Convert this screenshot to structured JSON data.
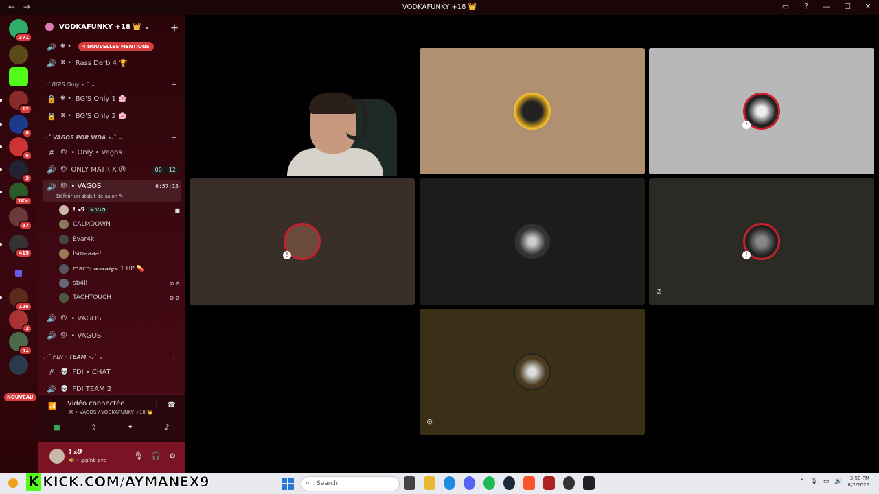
{
  "window": {
    "title": "VODKAFUNKY +18 👑",
    "nav_back": "←",
    "nav_forward": "→",
    "ctrl": [
      "▭",
      "?",
      "—",
      "☐",
      "✕"
    ]
  },
  "servers": {
    "badges": [
      "371",
      "12",
      "8",
      "6",
      "3",
      "1K+",
      "87",
      "415",
      "126",
      "2",
      "41"
    ],
    "nouveau": "NOUVEAU"
  },
  "server": {
    "name": "VODKAFUNKY +18 👑",
    "chevron": "⌄",
    "add_member": "＋"
  },
  "channels": {
    "c1_decor": "❋ •",
    "mention": "4 NOUVELLES MENTIONS",
    "c2_decor": "❋ •",
    "c2_name": "Rass Derb 4 🏆",
    "cat_bg": ".·˚ BG'S Only ⋆.˚ ⌄",
    "bg1": "BG'S Only 1 🌸",
    "bg2": "BG'S Only 2 🌸",
    "bg_decor": "❋ •",
    "cat_vagos": ".·˚ VAGOS POR VIDA ⋆.˚ ⌄",
    "only_vagos": "• Only • Vagos",
    "only_matrix": "ONLY MATRIX 😠",
    "matrix_count_a": "00",
    "matrix_count_b": "12",
    "vagos_active": "• VAGOS",
    "vagos_timer": "6:57:15",
    "status_prompt": "Définir un statut de salon ✎",
    "vagos2": "• VAGOS",
    "vagos3": "• VAGOS",
    "cat_fdi": ".·˚ FDI · TEAM ⋆.˚ ⌄",
    "fdi_chat": "FDI • CHAT",
    "fdi_team2": "FDI TEAM 2",
    "plus": "+"
  },
  "voice_users": [
    {
      "name": "! 𝓍9",
      "tag": "☠ VxG",
      "muted": ""
    },
    {
      "name": "CALMDOWN",
      "tag": "",
      "muted": ""
    },
    {
      "name": "Evar4k",
      "tag": "",
      "muted": ""
    },
    {
      "name": "Ismaaaa!",
      "tag": "",
      "muted": ""
    },
    {
      "name": "machi 𝓶𝓮𝓻𝓷𝓲𝓰𝓪 1 HP 💊",
      "tag": "",
      "muted": ""
    },
    {
      "name": "sb4ii",
      "tag": "",
      "muted": "⊘⊘"
    },
    {
      "name": "TACHTOUCH",
      "tag": "",
      "muted": "⊘⊘"
    }
  ],
  "voice_panel": {
    "status": "Vidéo connectée",
    "channel": "😠 • VAGOS / VODKAFUNKY +18 👑"
  },
  "user_panel": {
    "name": "! 𝓍9",
    "status": "🐝 • .gg/nb-pvp"
  },
  "taskbar": {
    "kick_letter": "K",
    "kick_url": "KICK.COM/AYMANEX9",
    "search_placeholder": "Search",
    "time": "3:50 PM",
    "date": "8/2/2026"
  },
  "colors": {
    "accent": "#d83c3e",
    "kick_green": "#53fc18",
    "speaking_ring": "#c8202c"
  }
}
